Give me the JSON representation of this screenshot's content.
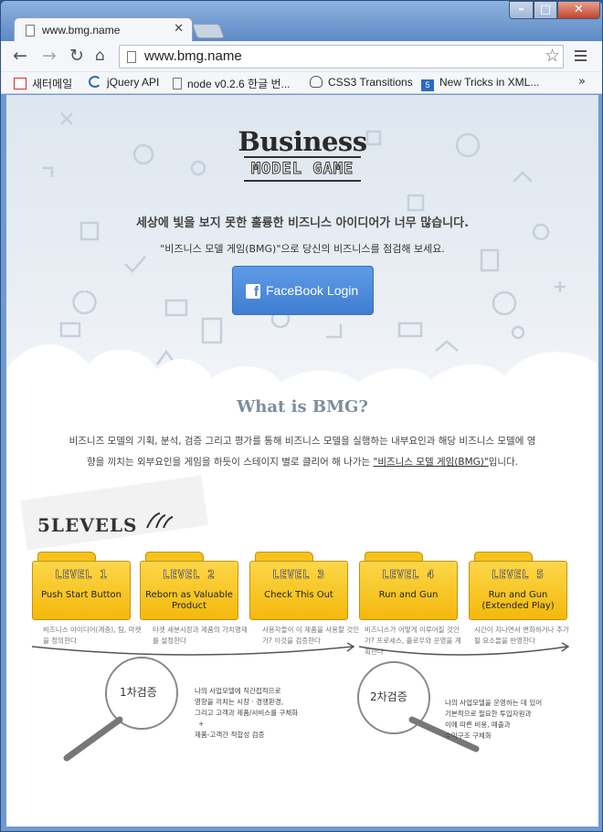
{
  "browser": {
    "tab_title": "www.bmg.name",
    "url": "www.bmg.name",
    "bookmarks": [
      {
        "label": "새터메일"
      },
      {
        "label": "jQuery API"
      },
      {
        "label": "node v0.2.6 한글 번..."
      },
      {
        "label": "CSS3 Transitions"
      },
      {
        "label": "New Tricks in XML..."
      }
    ],
    "more": "»"
  },
  "page": {
    "logo_line1": "Business",
    "logo_line2": "MODEL GAME",
    "tagline": "세상에 빛을 보지 못한 훌륭한 비즈니스 아이디어가 너무 많습니다.",
    "subline": "\"비즈니스 모델 게임(BMG)\"으로 당신의 비즈니스를 점검해 보세요.",
    "fb_button": "FaceBook Login",
    "what_title": "What is BMG?",
    "desc_line1": "비즈니즈 모델의 기획, 분석, 검증 그리고 평가를 통해 비즈니스 모델을 실행하는 내부요인과 해당 비즈니스 모델에 영",
    "desc_line2a": "향을 끼치는 외부요인을 게임을 하듯이 스테이지 별로 클리어 해 나가는 ",
    "desc_link": "\"비즈니스 모델 게임(BMG)\"",
    "desc_line2b": "입니다.",
    "levels_title": "5LEVELS",
    "levels": [
      {
        "level": "LEVEL 1",
        "title": "Push Start Button",
        "desc": "비즈니스 아이디어(계층), 팀, 마켓을 정의한다"
      },
      {
        "level": "LEVEL 2",
        "title": "Reborn as Valuable Product",
        "desc": "타겟 세분시장과 제품의 가치명제를 설정한다"
      },
      {
        "level": "LEVEL 3",
        "title": "Check This Out",
        "desc": "사용자들이 이 제품을 사용할 것인가? 이것을 검증한다"
      },
      {
        "level": "LEVEL 4",
        "title": "Run and Gun",
        "desc": "비즈니스가 어떻게 이루어질 것인가? 프로세스, 플로우와 운영을 계획한다"
      },
      {
        "level": "LEVEL 5",
        "title": "Run and Gun (Extended Play)",
        "desc": "시간이 지나면서 변화하거나 추가될 요소들을 반영한다"
      }
    ],
    "verify1_label": "1차검증",
    "verify1_desc": [
      "나의 사업모델에 직간접적으로",
      "영향을 끼치는 시장 · 경쟁환경,",
      "그리고 고객과 제품/서비스를 구체화",
      "+",
      "제품-고객간 적합성 검증"
    ],
    "verify2_label": "2차검증",
    "verify2_desc": [
      "나의 사업모델을 운영하는 데 있어",
      "기본적으로 필요한 투입자원과",
      "이에 따른 비용, 매출과",
      "수익구조 구체화"
    ]
  },
  "colors": {
    "folder": "#f4b80b",
    "fb": "#3f7dd1",
    "what": "#7c8e9e"
  }
}
